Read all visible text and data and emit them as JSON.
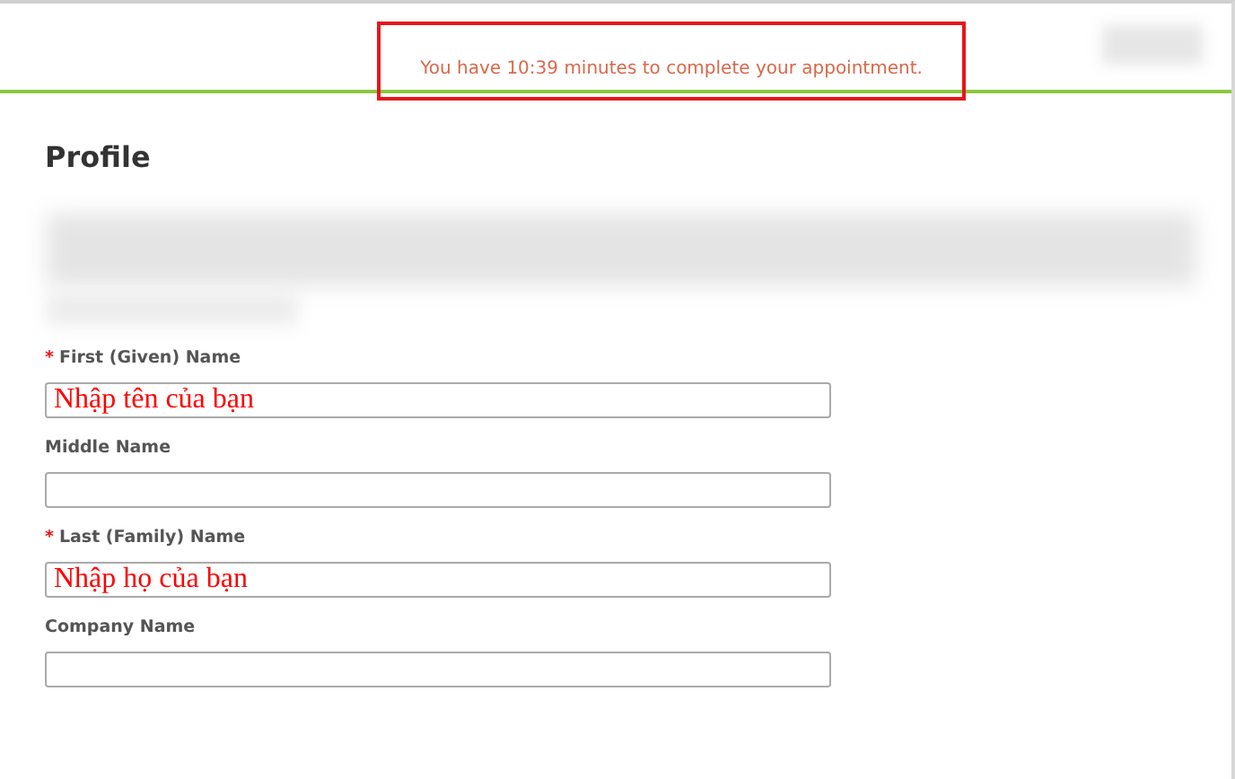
{
  "timer_notice": "You have 10:39 minutes to complete your appointment.",
  "heading": "Profile",
  "fields": [
    {
      "label": "First (Given) Name",
      "required_marker": "*",
      "value": "Nhập tên của bạn"
    },
    {
      "label": "Middle Name"
    },
    {
      "label": "Last (Family) Name",
      "required_marker": "*",
      "value": "Nhập họ của bạn"
    },
    {
      "label": "Company Name"
    }
  ]
}
